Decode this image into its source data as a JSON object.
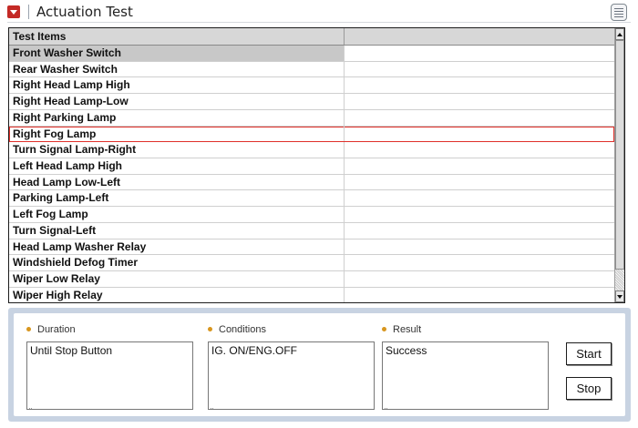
{
  "window": {
    "title": "Actuation Test"
  },
  "grid": {
    "header": {
      "col1": "Test Items",
      "col2": ""
    },
    "rows": [
      "Front Washer Switch",
      "Rear Washer Switch",
      "Right Head Lamp High",
      "Right Head Lamp-Low",
      "Right Parking Lamp",
      "Right Fog Lamp",
      "Turn Signal Lamp-Right",
      "Left Head Lamp High",
      "Head Lamp Low-Left",
      "Parking Lamp-Left",
      "Left Fog Lamp",
      "Turn Signal-Left",
      "Head Lamp Washer Relay",
      "Windshield Defog Timer",
      "Wiper Low Relay",
      "Wiper High Relay"
    ],
    "selected_row": "Front Washer Switch",
    "highlighted_row": "Right Fog Lamp"
  },
  "details": {
    "duration": {
      "label": "Duration",
      "value": "Until Stop Button"
    },
    "conditions": {
      "label": "Conditions",
      "value": "IG. ON/ENG.OFF"
    },
    "result": {
      "label": "Result",
      "value": "Success"
    }
  },
  "buttons": {
    "start": "Start",
    "stop": "Stop"
  },
  "colors": {
    "title_icon": "#c42a26",
    "highlight": "#e0302a",
    "panel_border": "#c8d3e2",
    "bullet": "#d8961e"
  },
  "icons": {
    "title": "dropdown-arrow-icon",
    "menu": "list-menu-icon"
  }
}
